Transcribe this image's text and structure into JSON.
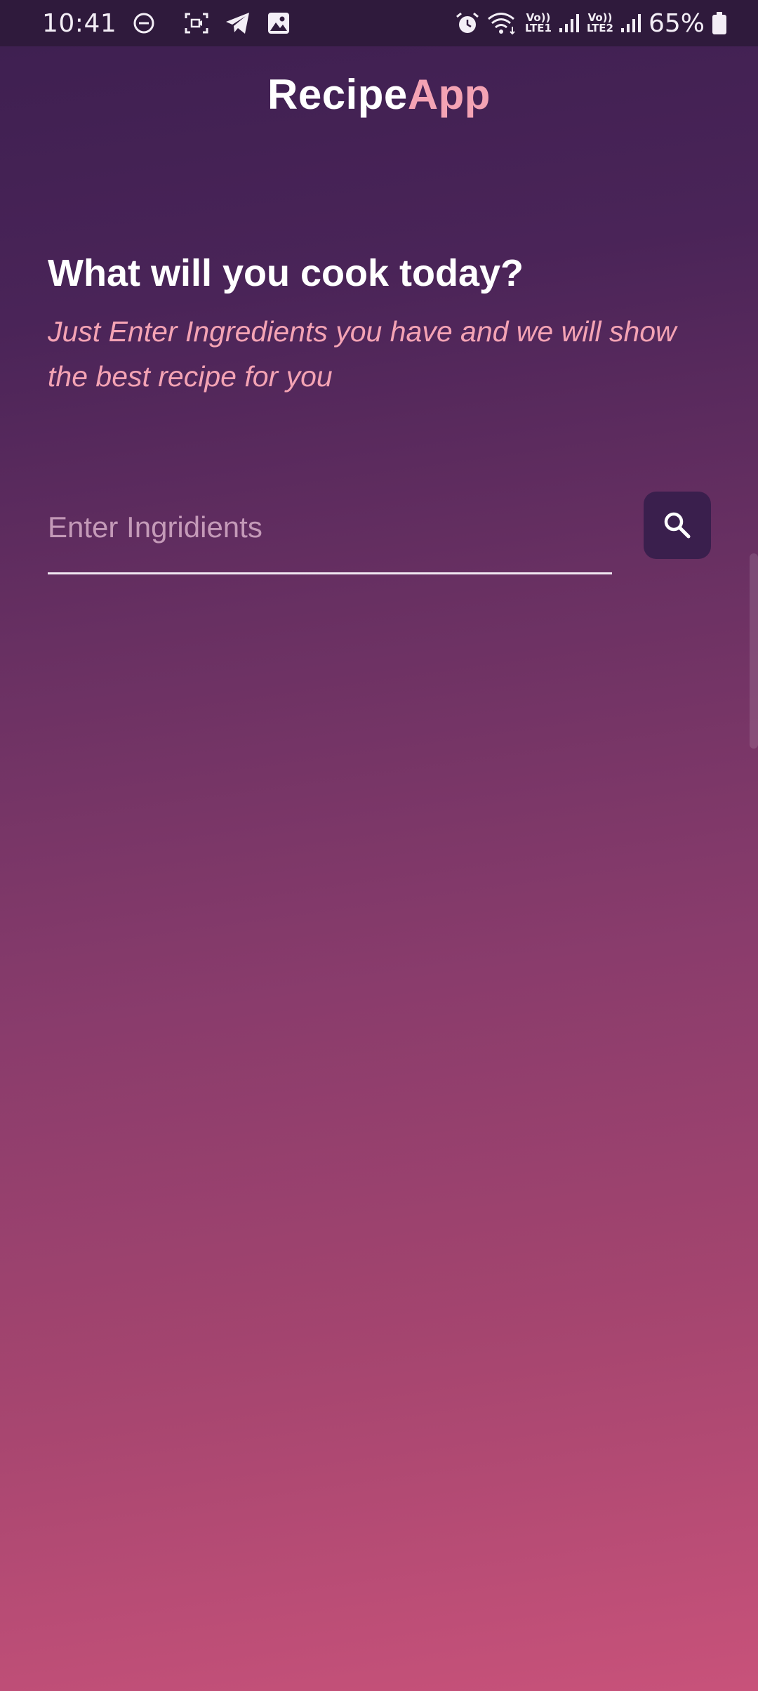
{
  "status_bar": {
    "time": "10:41",
    "battery": "65%",
    "sim1_top": "Vo))",
    "sim1_bottom": "LTE1",
    "sim2_top": "Vo))",
    "sim2_bottom": "LTE2",
    "icons": [
      "do-not-disturb-icon",
      "screen-record-icon",
      "telegram-icon",
      "gallery-icon",
      "alarm-icon",
      "wifi-icon",
      "signal-icon",
      "battery-icon"
    ]
  },
  "app": {
    "title_part1": "Recipe",
    "title_part2": "App",
    "accent_color": "#f4a3b4"
  },
  "hero": {
    "heading": "What will you cook today?",
    "subtitle": "Just Enter Ingredients you have and we will show the best recipe for you"
  },
  "search": {
    "placeholder": "Enter Ingridients",
    "value": "",
    "button_icon": "search-icon"
  }
}
